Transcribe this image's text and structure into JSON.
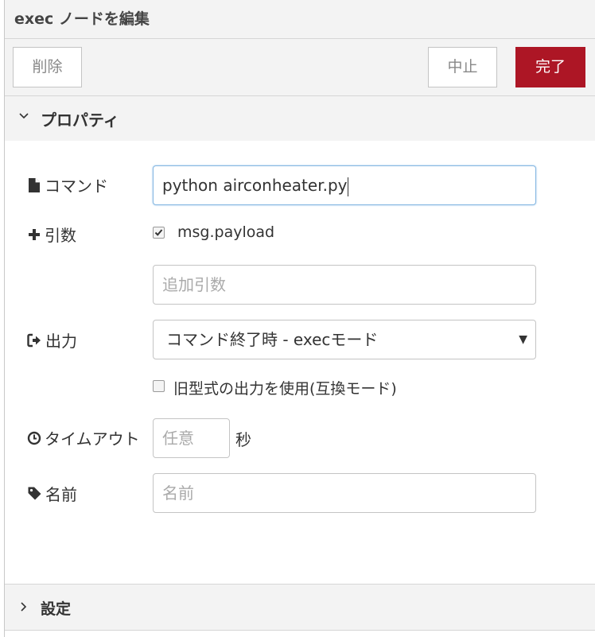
{
  "dialog": {
    "title": "exec ノードを編集"
  },
  "toolbar": {
    "delete_label": "削除",
    "cancel_label": "中止",
    "done_label": "完了"
  },
  "sections": {
    "properties_label": "プロパティ",
    "settings_label": "設定"
  },
  "form": {
    "command": {
      "label": "コマンド",
      "icon": "file-icon",
      "value": "python airconheater.py"
    },
    "args": {
      "label": "引数",
      "icon": "plus-icon",
      "payload_checkbox_label": "msg.payload",
      "payload_checked": true,
      "extra_placeholder": "追加引数"
    },
    "output": {
      "label": "出力",
      "icon": "sign-out-icon",
      "selected": "コマンド終了時 - execモード",
      "legacy_checkbox_label": "旧型式の出力を使用(互換モード)",
      "legacy_checked": false
    },
    "timeout": {
      "label": "タイムアウト",
      "icon": "clock-icon",
      "placeholder": "任意",
      "unit": "秒"
    },
    "name": {
      "label": "名前",
      "icon": "tag-icon",
      "placeholder": "名前"
    }
  },
  "colors": {
    "accent": "#ad1625",
    "focus_border": "#85b7e2",
    "header_bg": "#f3f3f3"
  }
}
